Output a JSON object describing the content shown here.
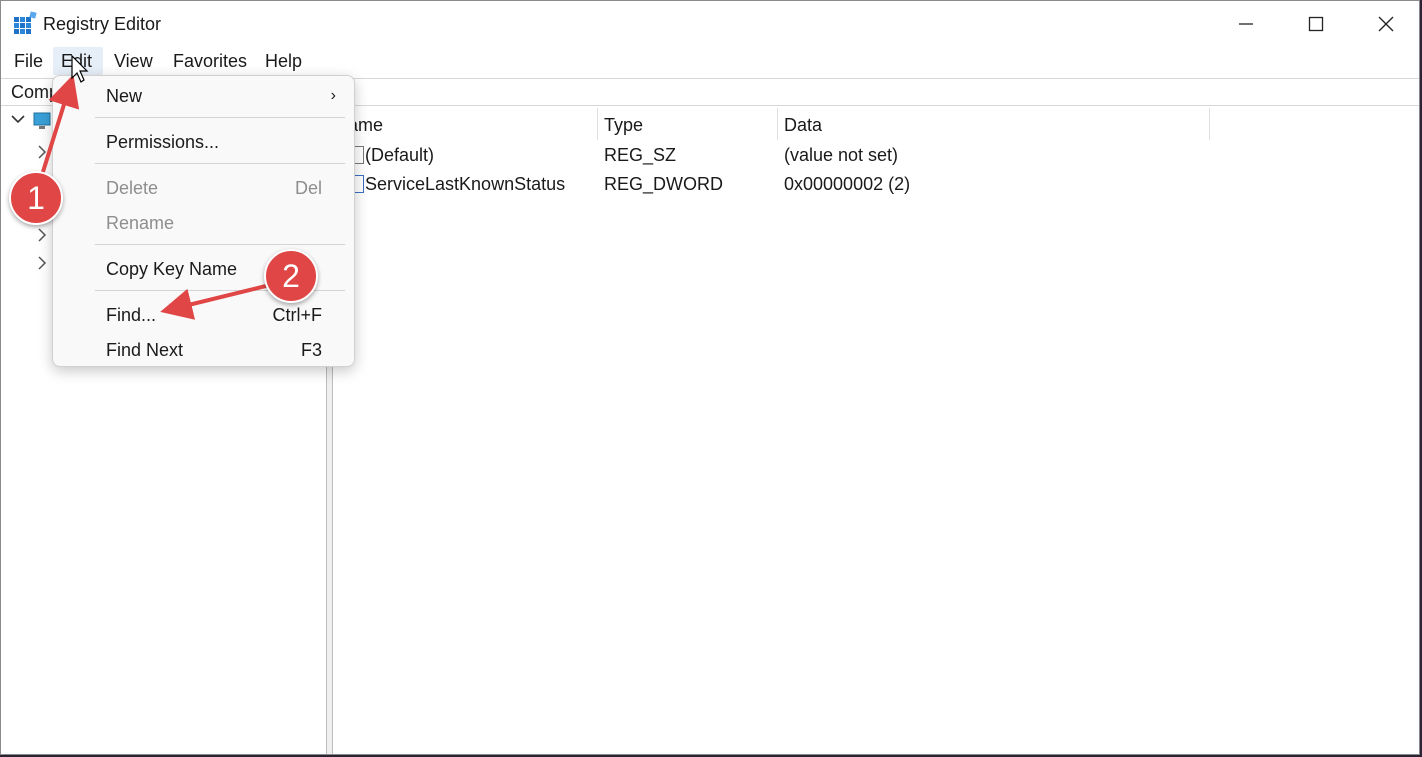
{
  "window": {
    "title": "Registry Editor",
    "controls": {
      "minimize": "minimize",
      "maximize": "maximize",
      "close": "close"
    }
  },
  "menubar": {
    "items": [
      "File",
      "Edit",
      "View",
      "Favorites",
      "Help"
    ],
    "active": "Edit"
  },
  "addressbar": {
    "path_visible": "Comp"
  },
  "list": {
    "columns": [
      "ame",
      "Type",
      "Data"
    ],
    "rows": [
      {
        "name": "(Default)",
        "type": "REG_SZ",
        "data": "(value not set)"
      },
      {
        "name": "ServiceLastKnownStatus",
        "type": "REG_DWORD",
        "data": "0x00000002 (2)"
      }
    ]
  },
  "edit_menu": {
    "items": [
      {
        "label": "New",
        "shortcut": "",
        "submenu": true,
        "disabled": false
      },
      {
        "label": "Permissions...",
        "shortcut": "",
        "disabled": false
      },
      {
        "label": "Delete",
        "shortcut": "Del",
        "disabled": true
      },
      {
        "label": "Rename",
        "shortcut": "",
        "disabled": true
      },
      {
        "label": "Copy Key Name",
        "shortcut": "",
        "disabled": false
      },
      {
        "label": "Find...",
        "shortcut": "Ctrl+F",
        "disabled": false
      },
      {
        "label": "Find Next",
        "shortcut": "F3",
        "disabled": false
      }
    ],
    "submenu_arrow": "›"
  },
  "annotations": {
    "step1": "1",
    "step2": "2",
    "color": "#e04646"
  },
  "icons": {
    "app": "registry-icon",
    "computer": "computer-icon",
    "value_string": "string-value-icon",
    "value_binary": "binary-value-icon"
  }
}
